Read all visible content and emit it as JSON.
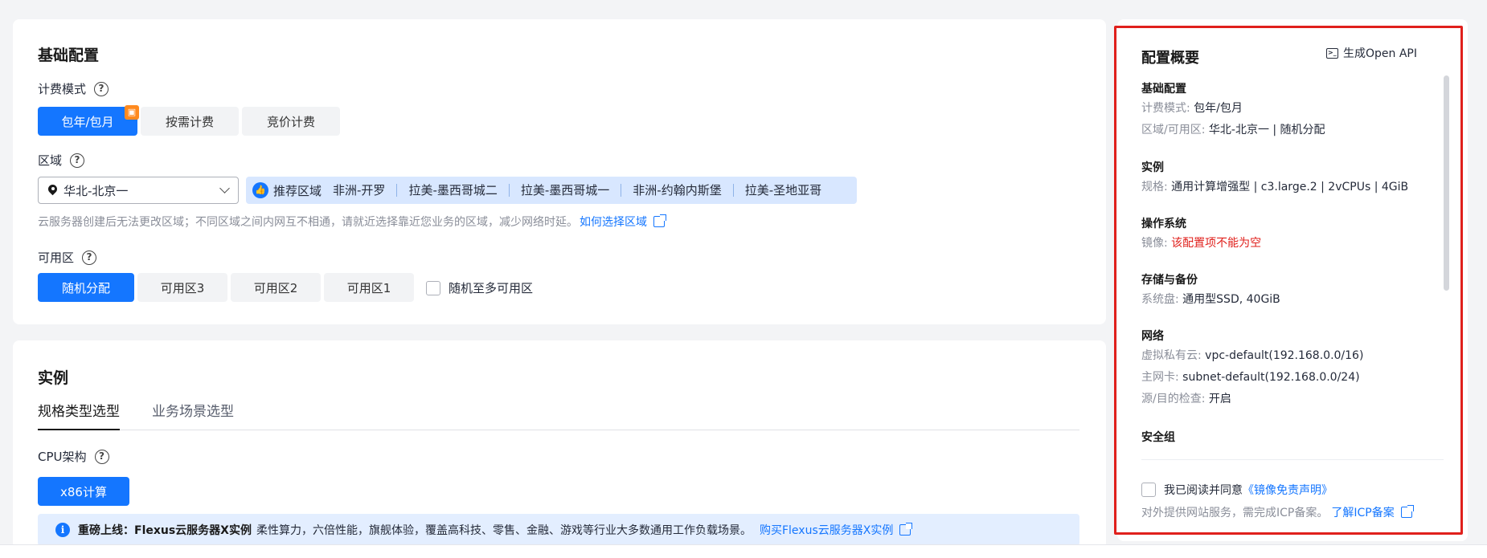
{
  "basic": {
    "title": "基础配置",
    "billing": {
      "label": "计费模式",
      "options": [
        "包年/包月",
        "按需计费",
        "竞价计费"
      ],
      "gift_icon": "gift-icon"
    },
    "region": {
      "label": "区域",
      "selected": "华北-北京一",
      "recommend_label": "推荐区域",
      "recommended": [
        "非洲-开罗",
        "拉美-墨西哥城二",
        "拉美-墨西哥城一",
        "非洲-约翰内斯堡",
        "拉美-圣地亚哥"
      ],
      "hint": "云服务器创建后无法更改区域；不同区域之间内网互不相通，请就近选择靠近您业务的区域，减少网络时延。",
      "hint_link": "如何选择区域"
    },
    "az": {
      "label": "可用区",
      "options": [
        "随机分配",
        "可用区3",
        "可用区2",
        "可用区1"
      ],
      "random_multi": "随机至多可用区"
    }
  },
  "instance": {
    "title": "实例",
    "tabs": [
      "规格类型选型",
      "业务场景选型"
    ],
    "cpu_label": "CPU架构",
    "cpu_option": "x86计算",
    "banner": {
      "bold": "重磅上线：Flexus云服务器X实例",
      "text": "柔性算力，六倍性能，旗舰体验，覆盖高科技、零售、金融、游戏等行业大多数通用工作负载场景。",
      "link": "购买Flexus云服务器X实例"
    }
  },
  "summary": {
    "title": "配置概要",
    "openapi": "生成Open API",
    "groups": {
      "basic": {
        "head": "基础配置",
        "billing_k": "计费模式: ",
        "billing_v": "包年/包月",
        "region_k": "区域/可用区: ",
        "region_v": "华北-北京一 | 随机分配"
      },
      "instance": {
        "head": "实例",
        "spec_k": "规格: ",
        "spec_v": "通用计算增强型 | c3.large.2 | 2vCPUs | 4GiB"
      },
      "os": {
        "head": "操作系统",
        "image_k": "镜像: ",
        "image_v": "该配置项不能为空"
      },
      "storage": {
        "head": "存储与备份",
        "disk_k": "系统盘: ",
        "disk_v": "通用型SSD, 40GiB"
      },
      "network": {
        "head": "网络",
        "vpc_k": "虚拟私有云: ",
        "vpc_v": "vpc-default(192.168.0.0/16)",
        "nic_k": "主网卡: ",
        "nic_v": "subnet-default(192.168.0.0/24)",
        "src_k": "源/目的检查: ",
        "src_v": "开启"
      },
      "sg": {
        "head": "安全组"
      }
    },
    "agree_text": "我已阅读并同意",
    "agree_link": "《镜像免责声明》",
    "icp_text": "对外提供网站服务，需完成ICP备案。",
    "icp_link": "了解ICP备案"
  },
  "colors": {
    "accent": "#1476ff",
    "error": "#e0201c",
    "frame": "#e0201c"
  }
}
